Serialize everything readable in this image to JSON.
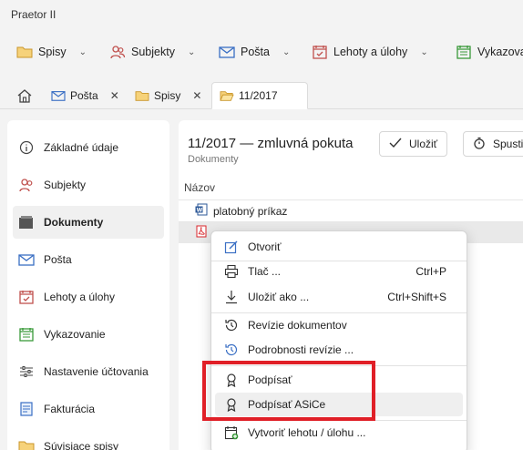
{
  "app": {
    "title": "Praetor II"
  },
  "menubar": {
    "items": [
      {
        "label": "Spisy",
        "icon": "folder-icon"
      },
      {
        "label": "Subjekty",
        "icon": "people-icon"
      },
      {
        "label": "Pošta",
        "icon": "mail-icon"
      },
      {
        "label": "Lehoty a úlohy",
        "icon": "calendar-alert-icon"
      },
      {
        "label": "Vykazova",
        "icon": "calendar-check-icon"
      }
    ]
  },
  "tabs": [
    {
      "label": "Pošta"
    },
    {
      "label": "Spisy"
    },
    {
      "label": "11/2017",
      "active": true
    }
  ],
  "sidebar": {
    "items": [
      {
        "label": "Základné údaje"
      },
      {
        "label": "Subjekty"
      },
      {
        "label": "Dokumenty",
        "active": true
      },
      {
        "label": "Pošta"
      },
      {
        "label": "Lehoty a úlohy"
      },
      {
        "label": "Vykazovanie"
      },
      {
        "label": "Nastavenie účtovania"
      },
      {
        "label": "Fakturácia"
      },
      {
        "label": "Súvisiace spisy"
      }
    ]
  },
  "main": {
    "title": "11/2017 — zmluvná pokuta",
    "subtitle": "Dokumenty",
    "save_label": "Uložiť",
    "start_label": "Spusti",
    "column_name": "Názov",
    "rows": [
      {
        "name": "platobný príkaz",
        "type": "word"
      },
      {
        "name": "",
        "type": "pdf"
      }
    ]
  },
  "context_menu": {
    "items": [
      {
        "label": "Otvoriť",
        "shortcut": ""
      },
      {
        "label": "Tlač ...",
        "shortcut": "Ctrl+P"
      },
      {
        "label": "Uložiť ako ...",
        "shortcut": "Ctrl+Shift+S"
      },
      {
        "label": "Revízie dokumentov",
        "shortcut": ""
      },
      {
        "label": "Podrobnosti revízie ...",
        "shortcut": ""
      },
      {
        "label": "Podpísať",
        "shortcut": ""
      },
      {
        "label": "Podpísať ASiCe",
        "shortcut": ""
      },
      {
        "label": "Vytvoriť lehotu / úlohu ...",
        "shortcut": ""
      }
    ]
  },
  "colors": {
    "highlight": "#e01f27",
    "word": "#2b5797",
    "pdf": "#d9262b",
    "accent": "#3a6fc4"
  }
}
